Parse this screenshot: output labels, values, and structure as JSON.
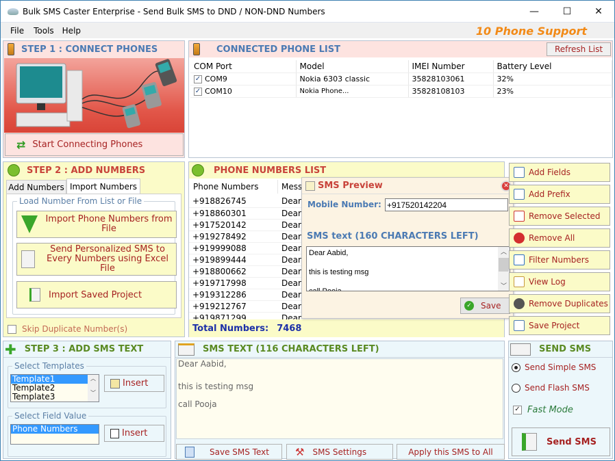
{
  "window": {
    "title": "Bulk SMS Caster Enterprise - Send Bulk SMS to DND / NON-DND Numbers",
    "minimize": "—",
    "maximize": "☐",
    "close": "✕"
  },
  "menu": {
    "items": [
      "File",
      "Tools",
      "Help"
    ],
    "support_label": "10 Phone Support"
  },
  "step1": {
    "title": "STEP 1 : CONNECT PHONES",
    "connect_button": "Start Connecting Phones"
  },
  "connected_list": {
    "title": "CONNECTED PHONE LIST",
    "refresh_button": "Refresh List",
    "columns": [
      "COM  Port",
      "Model",
      "IMEI Number",
      "Battery Level"
    ],
    "rows": [
      {
        "checked": true,
        "port": "COM9",
        "model": "Nokia 6303 classic",
        "imei": "35828103061",
        "battery": "32%"
      },
      {
        "checked": true,
        "port": "COM10",
        "model": "Nokia Phone...",
        "imei": "35828108103",
        "battery": "23%"
      }
    ]
  },
  "step2": {
    "title": "STEP 2 : ADD NUMBERS",
    "tabs": [
      "Add Numbers",
      "Import Numbers"
    ],
    "active_tab": 1,
    "group_label": "Load Number From List or File",
    "import_file_button": "Import Phone Numbers from File",
    "personalized_button": "Send Personalized SMS to Every Numbers using Excel File",
    "import_project_button": "Import Saved Project",
    "skip_duplicates_label": "Skip Duplicate Number(s)",
    "skip_duplicates_checked": false
  },
  "numbers_list": {
    "title": "PHONE NUMBERS LIST",
    "columns": [
      "Phone Numbers",
      "Message"
    ],
    "rows": [
      {
        "number": "+918826745",
        "message": "Dear"
      },
      {
        "number": "+918860301",
        "message": "Dear"
      },
      {
        "number": "+917520142",
        "message": "Dear"
      },
      {
        "number": "+919278492",
        "message": "Dear"
      },
      {
        "number": "+919999088",
        "message": "Dear"
      },
      {
        "number": "+919899444",
        "message": "Dear"
      },
      {
        "number": "+918800662",
        "message": "Dear"
      },
      {
        "number": "+919717998",
        "message": "Dear"
      },
      {
        "number": "+919312286",
        "message": "Dear"
      },
      {
        "number": "+919212767",
        "message": "Dear"
      },
      {
        "number": "+919871299.....",
        "message": "Dear"
      }
    ],
    "total_label": "Total Numbers:",
    "total_value": "7468"
  },
  "sms_preview": {
    "title": "SMS Preview",
    "mobile_label": "Mobile Number:",
    "mobile_value": "+917520142204",
    "sms_label": "SMS text (160 CHARACTERS LEFT)",
    "sms_lines": [
      "Dear Aabid,",
      "",
      "this is testing msg",
      "",
      "call Pooja"
    ],
    "save_button": "Save"
  },
  "side_actions": [
    {
      "label": "Add Fields",
      "icon": "add-fields-icon"
    },
    {
      "label": "Add Prefix",
      "icon": "add-prefix-icon"
    },
    {
      "label": "Remove Selected",
      "icon": "remove-selected-icon"
    },
    {
      "label": "Remove All",
      "icon": "remove-all-icon"
    },
    {
      "label": "Filter Numbers",
      "icon": "filter-icon"
    },
    {
      "label": "View Log",
      "icon": "log-icon"
    },
    {
      "label": "Remove Duplicates",
      "icon": "remove-duplicates-icon"
    },
    {
      "label": "Save Project",
      "icon": "save-project-icon"
    }
  ],
  "step3": {
    "title": "STEP 3 : ADD SMS TEXT",
    "templates_label": "Select Templates",
    "templates": [
      "Template1",
      "Template2",
      "Template3"
    ],
    "selected_template": 0,
    "insert_template_button": "Insert",
    "field_label": "Select Field Value",
    "fields": [
      "Phone Numbers"
    ],
    "selected_field": 0,
    "insert_field_button": "Insert"
  },
  "sms_text": {
    "title": "SMS TEXT (116 CHARACTERS LEFT)",
    "lines": [
      "Dear Aabid,",
      "this is testing msg",
      "call Pooja"
    ],
    "save_button": "Save SMS Text",
    "settings_button": "SMS Settings",
    "apply_button": "Apply this SMS to All"
  },
  "send": {
    "title": "SEND SMS",
    "simple_label": "Send Simple SMS",
    "flash_label": "Send Flash SMS",
    "mode": "simple",
    "fast_mode_label": "Fast Mode",
    "fast_mode_checked": true,
    "send_button": "Send SMS"
  }
}
